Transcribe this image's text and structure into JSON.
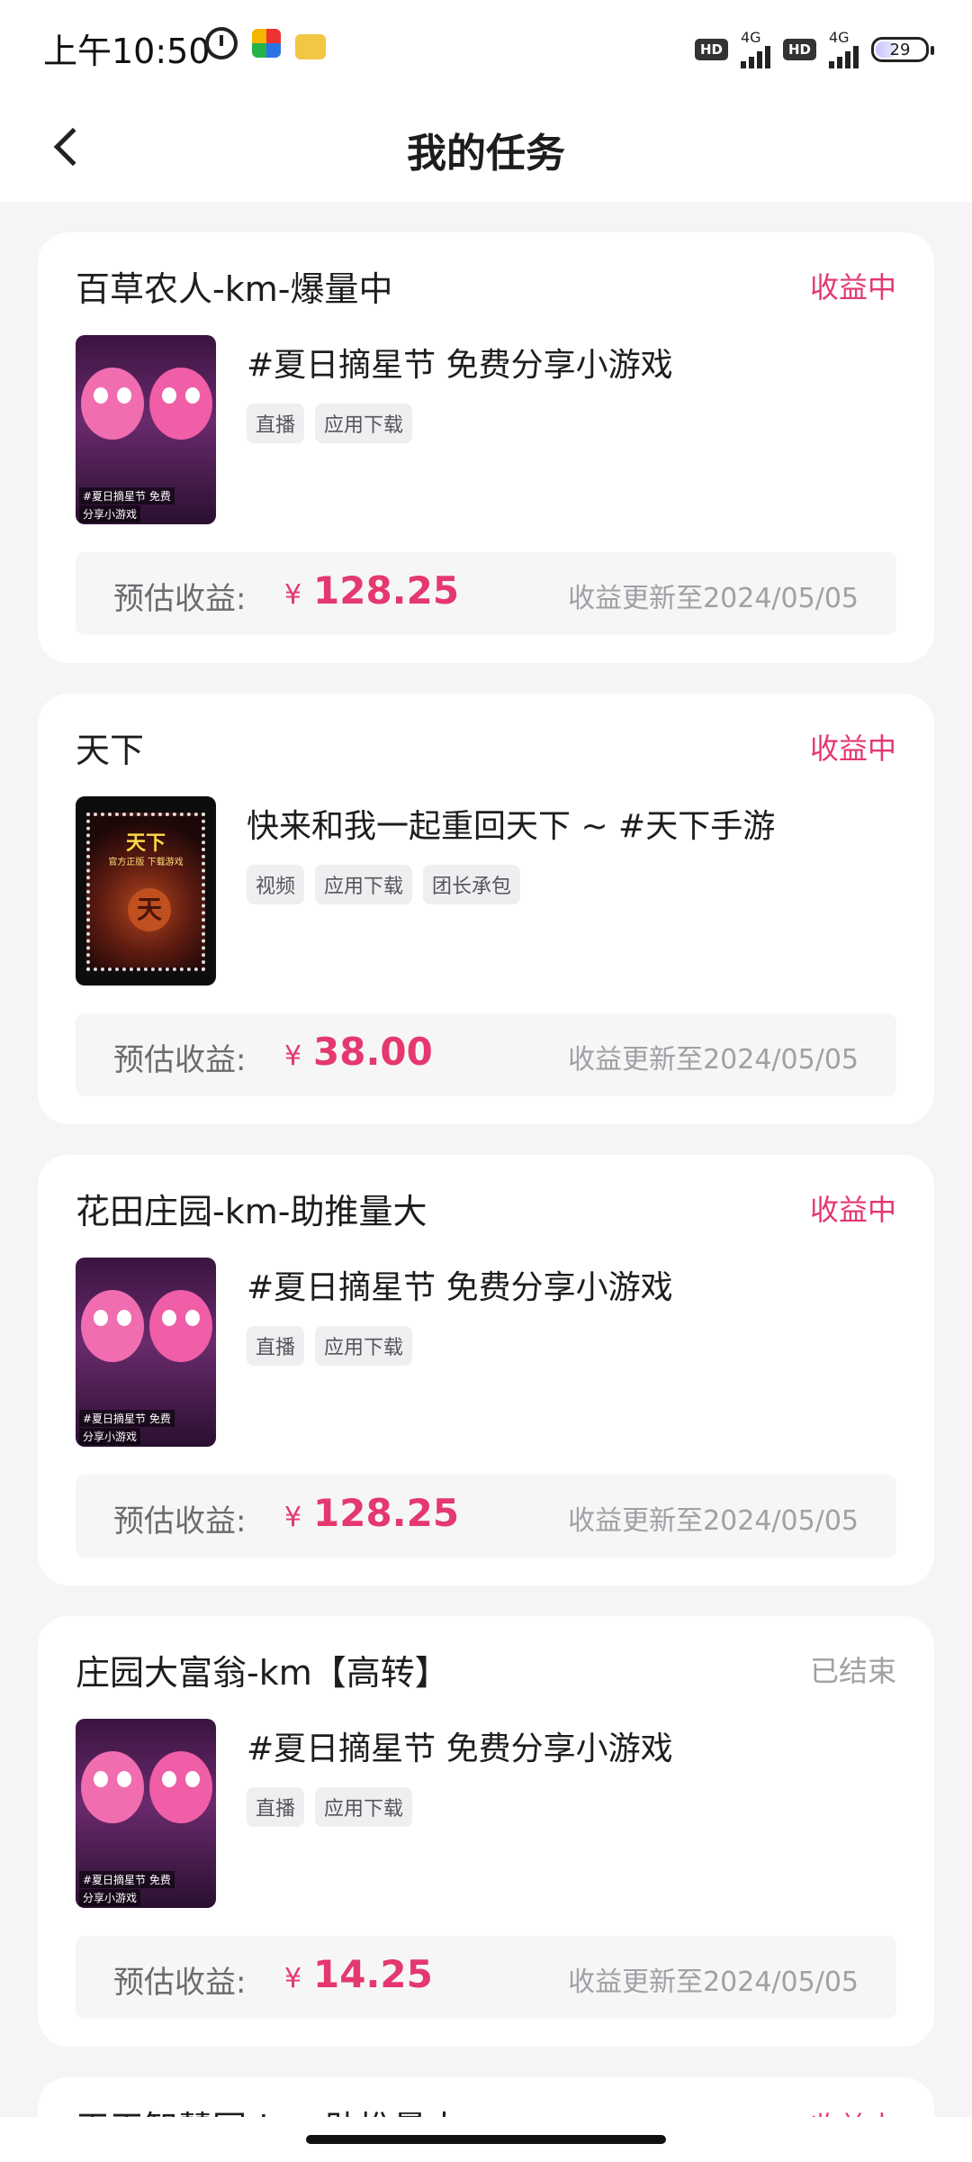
{
  "status_bar": {
    "time": "上午10:50",
    "hd_label": "HD",
    "network": "4G",
    "battery": "29"
  },
  "nav": {
    "title": "我的任务"
  },
  "tasks": [
    {
      "name": "百草农人-km-爆量中",
      "status": "收益中",
      "desc": "#夏日摘星节 免费分享小游戏",
      "tags": [
        "直播",
        "应用下载"
      ],
      "thumb_caption_1": "#夏日摘星节 免费",
      "thumb_caption_2": "分享小游戏",
      "earn_label": "预估收益:",
      "currency": "¥",
      "earn_value": "128.25",
      "updated": "收益更新至2024/05/05"
    },
    {
      "name": "天下",
      "status": "收益中",
      "desc": "快来和我一起重回天下 ~ #天下手游",
      "tags": [
        "视频",
        "应用下载",
        "团长承包"
      ],
      "stamp_title": "天下",
      "stamp_sub": "官方正版 下载游戏",
      "stamp_char": "天",
      "earn_label": "预估收益:",
      "currency": "¥",
      "earn_value": "38.00",
      "updated": "收益更新至2024/05/05"
    },
    {
      "name": "花田庄园-km-助推量大",
      "status": "收益中",
      "desc": "#夏日摘星节 免费分享小游戏",
      "tags": [
        "直播",
        "应用下载"
      ],
      "thumb_caption_1": "#夏日摘星节 免费",
      "thumb_caption_2": "分享小游戏",
      "earn_label": "预估收益:",
      "currency": "¥",
      "earn_value": "128.25",
      "updated": "收益更新至2024/05/05"
    },
    {
      "name": "庄园大富翁-km【高转】",
      "status": "已结束",
      "desc": "#夏日摘星节 免费分享小游戏",
      "tags": [
        "直播",
        "应用下载"
      ],
      "thumb_caption_1": "#夏日摘星节 免费",
      "thumb_caption_2": "分享小游戏",
      "earn_label": "预估收益:",
      "currency": "¥",
      "earn_value": "14.25",
      "updated": "收益更新至2024/05/05"
    },
    {
      "name": "天天智慧园-km-助推量大",
      "status": "收益中"
    }
  ],
  "colors": {
    "accent": "#e4386e",
    "muted": "#a0a0a5",
    "background": "#f5f5f7"
  }
}
